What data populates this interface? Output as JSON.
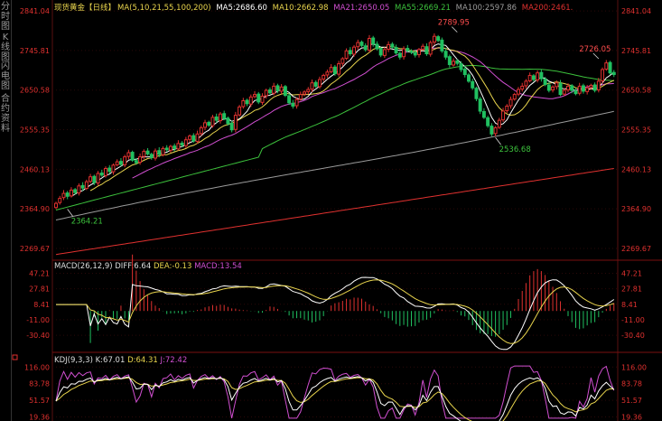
{
  "side_tabs": [
    "分时图",
    "K线图",
    "闪电图",
    "合约资料"
  ],
  "header": {
    "instrument": "现货黄金",
    "period": "【日线】",
    "ma_set": "MA(5,10,21,55,100,200)",
    "ma_values": [
      {
        "label": "MA5:2686.60",
        "color": "#ffffff"
      },
      {
        "label": "MA10:2662.98",
        "color": "#e8d44d"
      },
      {
        "label": "MA21:2650.05",
        "color": "#d14fd1"
      },
      {
        "label": "MA55:2669.21",
        "color": "#3cc13c"
      },
      {
        "label": "MA100:2597.86",
        "color": "#9a9a9a"
      },
      {
        "label": "MA200:2461.",
        "color": "#e0312f"
      }
    ]
  },
  "macd_header": {
    "name": "MACD(26,12,9)",
    "diff": "DIFF:6.64",
    "dea": "DEA:-0.13",
    "macd": "MACD:13.54"
  },
  "kdj_header": {
    "name": "KDJ(9,3,3)",
    "k": "K:67.01",
    "d": "D:64.31",
    "j": "J:72.42"
  },
  "colors": {
    "up": "#e0312f",
    "down": "#20c060",
    "axis": "#e0312f",
    "grid": "#7a1010"
  },
  "chart_data": [
    {
      "type": "candlestick",
      "ylim": [
        2250,
        2850
      ],
      "y_ticks": [
        2841.04,
        2745.81,
        2650.58,
        2555.35,
        2460.13,
        2364.9,
        2269.67
      ],
      "annotations": [
        {
          "text": "2789.95",
          "x": 105,
          "y": 2789.95
        },
        {
          "text": "2726.05",
          "x": 142,
          "y": 2726.05
        },
        {
          "text": "2536.68",
          "x": 115,
          "y": 2536.68
        },
        {
          "text": "2364.21",
          "x": 3,
          "y": 2364.21
        }
      ],
      "close": [
        2378,
        2390,
        2402,
        2395,
        2410,
        2404,
        2420,
        2415,
        2430,
        2442,
        2428,
        2450,
        2446,
        2462,
        2455,
        2470,
        2478,
        2472,
        2490,
        2500,
        2482,
        2476,
        2490,
        2503,
        2497,
        2488,
        2504,
        2496,
        2510,
        2507,
        2515,
        2510,
        2522,
        2518,
        2531,
        2540,
        2528,
        2545,
        2560,
        2572,
        2566,
        2585,
        2578,
        2593,
        2582,
        2570,
        2555,
        2590,
        2610,
        2625,
        2618,
        2634,
        2640,
        2622,
        2636,
        2650,
        2644,
        2660,
        2649,
        2658,
        2638,
        2620,
        2612,
        2628,
        2640,
        2646,
        2652,
        2668,
        2660,
        2676,
        2686,
        2694,
        2705,
        2690,
        2714,
        2726,
        2745,
        2738,
        2754,
        2765,
        2758,
        2748,
        2775,
        2762,
        2750,
        2735,
        2748,
        2760,
        2754,
        2740,
        2730,
        2750,
        2745,
        2742,
        2735,
        2748,
        2756,
        2738,
        2765,
        2780,
        2770,
        2745,
        2730,
        2712,
        2720,
        2715,
        2700,
        2688,
        2672,
        2656,
        2630,
        2600,
        2585,
        2565,
        2545,
        2560,
        2578,
        2600,
        2612,
        2628,
        2640,
        2652,
        2660,
        2672,
        2686,
        2676,
        2692,
        2678,
        2664,
        2650,
        2658,
        2668,
        2640,
        2650,
        2660,
        2650,
        2642,
        2660,
        2648,
        2656,
        2662,
        2650,
        2672,
        2700,
        2716,
        2692,
        2688
      ],
      "open": [
        2368,
        2380,
        2392,
        2403,
        2396,
        2411,
        2403,
        2421,
        2414,
        2431,
        2443,
        2427,
        2451,
        2445,
        2463,
        2454,
        2471,
        2479,
        2471,
        2491,
        2501,
        2481,
        2477,
        2491,
        2504,
        2496,
        2487,
        2505,
        2495,
        2511,
        2506,
        2516,
        2509,
        2523,
        2517,
        2532,
        2541,
        2527,
        2546,
        2561,
        2573,
        2565,
        2586,
        2577,
        2594,
        2583,
        2571,
        2556,
        2591,
        2611,
        2626,
        2617,
        2635,
        2641,
        2621,
        2637,
        2651,
        2643,
        2661,
        2648,
        2659,
        2637,
        2619,
        2613,
        2629,
        2641,
        2647,
        2653,
        2669,
        2659,
        2677,
        2687,
        2695,
        2706,
        2689,
        2715,
        2727,
        2746,
        2737,
        2755,
        2766,
        2757,
        2747,
        2776,
        2761,
        2751,
        2734,
        2749,
        2761,
        2753,
        2739,
        2731,
        2751,
        2744,
        2741,
        2736,
        2749,
        2755,
        2737,
        2766,
        2779,
        2771,
        2744,
        2731,
        2711,
        2721,
        2714,
        2701,
        2687,
        2671,
        2655,
        2629,
        2599,
        2584,
        2564,
        2546,
        2561,
        2579,
        2601,
        2613,
        2629,
        2641,
        2653,
        2661,
        2673,
        2685,
        2675,
        2693,
        2677,
        2663,
        2651,
        2659,
        2667,
        2641,
        2651,
        2661,
        2649,
        2643,
        2661,
        2647,
        2657,
        2663,
        2651,
        2673,
        2701,
        2717,
        2693
      ]
    },
    {
      "type": "bar+line",
      "name": "MACD",
      "ylim": [
        -45,
        50
      ],
      "y_ticks": [
        47.21,
        27.81,
        8.41,
        -11.0,
        -30.4
      ]
    },
    {
      "type": "line",
      "name": "KDJ",
      "ylim": [
        15,
        120
      ],
      "y_ticks": [
        116.0,
        83.78,
        51.57,
        19.36
      ]
    }
  ]
}
